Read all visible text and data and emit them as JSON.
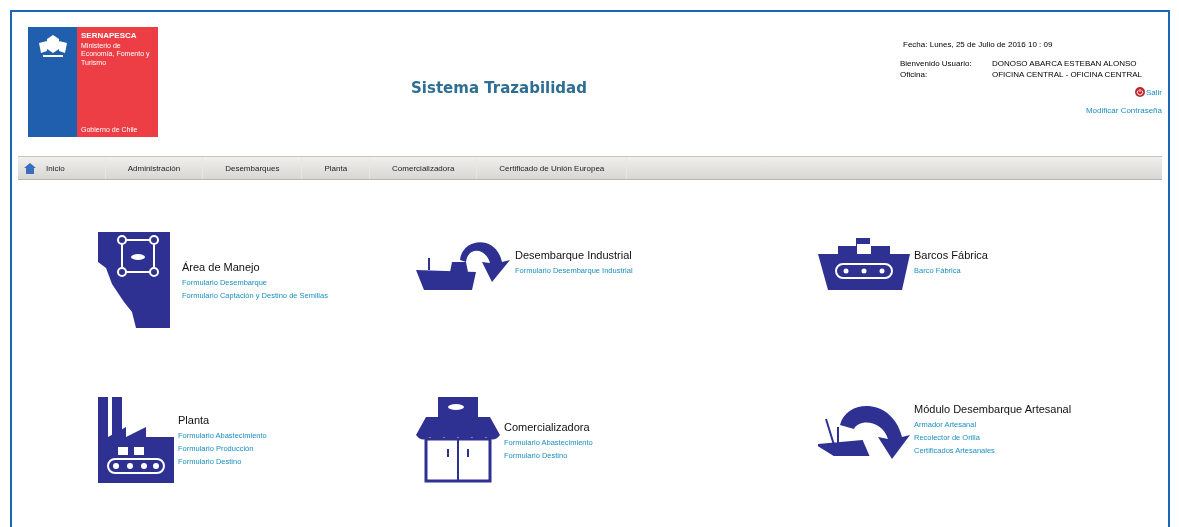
{
  "logo": {
    "title": "SERNAPESCA",
    "subtitle": "Ministerio de Economía, Fomento y Turismo",
    "footer": "Gobierno de Chile"
  },
  "header": {
    "title": "Sistema Trazabilidad",
    "date": "Fecha: Lunes, 25 de Julio de 2016  10 : 09",
    "user_label": "Bienvenido Usuario:",
    "user": "DONOSO ABARCA ESTEBAN ALONSO",
    "office_label": "Oficina:",
    "office": "OFICINA CENTRAL - OFICINA CENTRAL",
    "logout": "Salir",
    "change_password": "Modificar Contraseña"
  },
  "nav": [
    {
      "label": "Inicio",
      "kind": "home"
    },
    {
      "label": "Administración",
      "kind": "plain"
    },
    {
      "label": "Desembarques",
      "kind": "plain"
    },
    {
      "label": "Planta",
      "kind": "plain"
    },
    {
      "label": "Comercializadora",
      "kind": "plain"
    },
    {
      "label": "Certificado de Unión Europea",
      "kind": "plain"
    }
  ],
  "modules": [
    {
      "kind": "area",
      "title": "Área de Manejo",
      "links": [
        "Formulario Desembarque",
        "Formulario Captación y Destino de Semillas"
      ]
    },
    {
      "kind": "industrial",
      "title": "Desembarque Industrial",
      "links": [
        "Formulario Desembarque Industrial"
      ]
    },
    {
      "kind": "ship",
      "title": "Barcos Fábrica",
      "links": [
        "Barco Fábrica"
      ]
    },
    {
      "kind": "plant",
      "title": "Planta",
      "links": [
        "Formulario Abastecimiento",
        "Formulario Producción",
        "Formulario Destino"
      ]
    },
    {
      "kind": "store",
      "title": "Comercializadora",
      "links": [
        "Formulario Abastecimiento",
        "Formulario Destino"
      ]
    },
    {
      "kind": "artisanal",
      "title": "Módulo Desembarque Artesanal",
      "links": [
        "Armador Artesanal",
        "Recolector de Orilla",
        "Certificados Artesanales"
      ]
    }
  ]
}
